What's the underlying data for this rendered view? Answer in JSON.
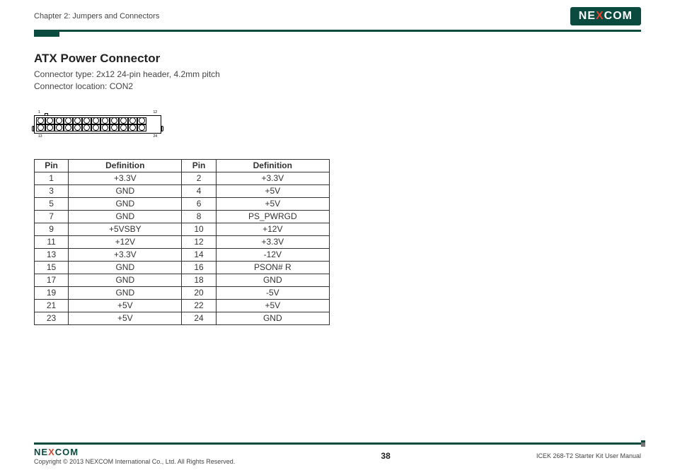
{
  "header": {
    "chapter": "Chapter 2: Jumpers and Connectors",
    "logo_text_pre": "NE",
    "logo_text_x": "X",
    "logo_text_post": "COM"
  },
  "section": {
    "title": "ATX Power Connector",
    "line1": "Connector type: 2x12 24-pin header, 4.2mm pitch",
    "line2": "Connector location: CON2"
  },
  "diagram": {
    "top_left": "1",
    "top_right": "12",
    "bottom_left": "13",
    "bottom_right": "24",
    "pin_count_per_row": 12
  },
  "table": {
    "headers": {
      "pin": "Pin",
      "def": "Definition"
    },
    "rows": [
      {
        "p1": "1",
        "d1": "+3.3V",
        "p2": "2",
        "d2": "+3.3V"
      },
      {
        "p1": "3",
        "d1": "GND",
        "p2": "4",
        "d2": "+5V"
      },
      {
        "p1": "5",
        "d1": "GND",
        "p2": "6",
        "d2": "+5V"
      },
      {
        "p1": "7",
        "d1": "GND",
        "p2": "8",
        "d2": "PS_PWRGD"
      },
      {
        "p1": "9",
        "d1": "+5VSBY",
        "p2": "10",
        "d2": "+12V"
      },
      {
        "p1": "11",
        "d1": "+12V",
        "p2": "12",
        "d2": "+3.3V"
      },
      {
        "p1": "13",
        "d1": "+3.3V",
        "p2": "14",
        "d2": "-12V"
      },
      {
        "p1": "15",
        "d1": "GND",
        "p2": "16",
        "d2": "PSON# R"
      },
      {
        "p1": "17",
        "d1": "GND",
        "p2": "18",
        "d2": "GND"
      },
      {
        "p1": "19",
        "d1": "GND",
        "p2": "20",
        "d2": "-5V"
      },
      {
        "p1": "21",
        "d1": "+5V",
        "p2": "22",
        "d2": "+5V"
      },
      {
        "p1": "23",
        "d1": "+5V",
        "p2": "24",
        "d2": "GND"
      }
    ]
  },
  "footer": {
    "copyright": "Copyright © 2013 NEXCOM International Co., Ltd. All Rights Reserved.",
    "page": "38",
    "manual": "ICEK 268-T2 Starter Kit User Manual"
  }
}
